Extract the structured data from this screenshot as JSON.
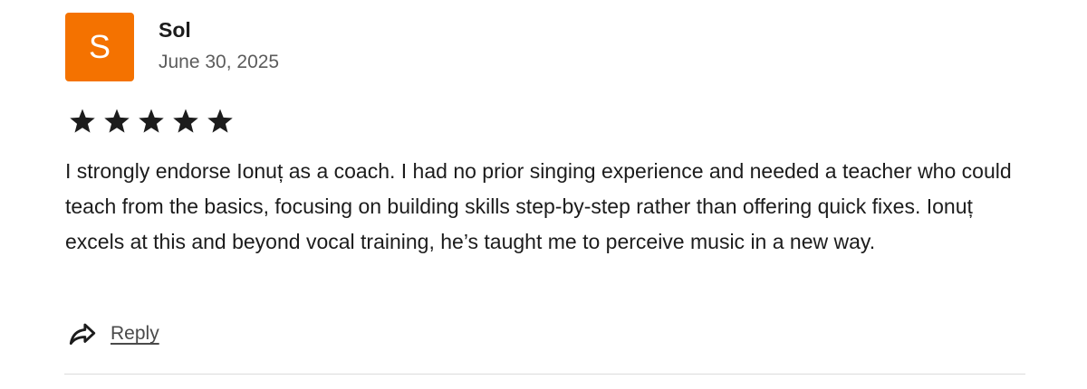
{
  "review": {
    "author_initial": "S",
    "author_name": "Sol",
    "date": "June 30, 2025",
    "rating": 5,
    "rating_max": 5,
    "text": "I strongly endorse Ionuț as a coach. I had no prior singing experience and needed a teacher who could teach from the basics, focusing on building skills step-by-step rather than offering quick fixes. Ionuț excels at this and beyond vocal training, he’s taught me to perceive music in a new way.",
    "reply_label": "Reply"
  },
  "colors": {
    "avatar_bg": "#f47200",
    "star": "#1c1c1c",
    "text": "#1c1c1c",
    "muted": "#5c5c5c"
  },
  "icons": {
    "star": "star-icon",
    "reply": "reply-arrow-icon"
  }
}
